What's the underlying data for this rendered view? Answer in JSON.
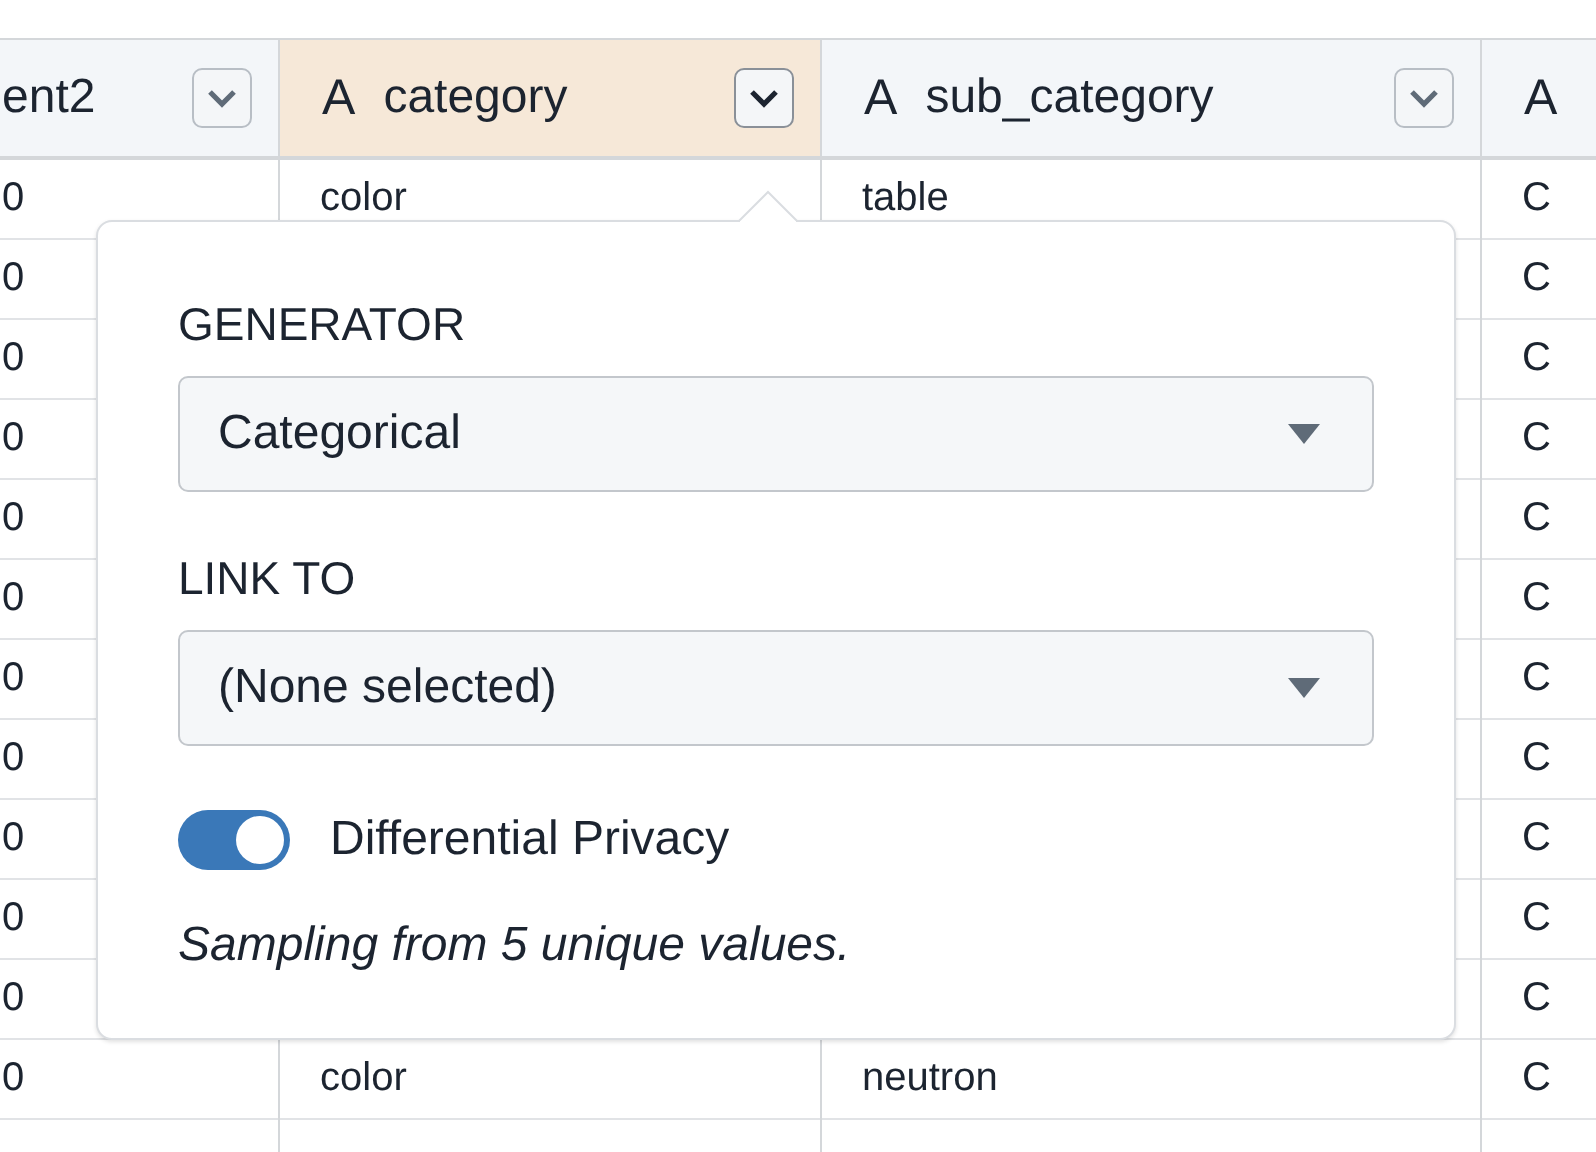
{
  "table": {
    "columns": [
      {
        "label": "ent2",
        "selected": false
      },
      {
        "label": "category",
        "type_glyph": "A",
        "selected": true
      },
      {
        "label": "sub_category",
        "type_glyph": "A",
        "selected": false
      },
      {
        "type_glyph": "A",
        "selected": false
      }
    ],
    "rows": [
      {
        "column_1": "0",
        "category": "color",
        "sub_category": "table",
        "column_4": "C"
      },
      {
        "column_1": "0",
        "column_4": "C"
      },
      {
        "column_1": "0",
        "column_4": "C"
      },
      {
        "column_1": "0",
        "column_4": "C"
      },
      {
        "column_1": "0",
        "column_4": "C"
      },
      {
        "column_1": "0",
        "column_4": "C"
      },
      {
        "column_1": "0",
        "column_4": "C"
      },
      {
        "column_1": "0",
        "column_4": "C"
      },
      {
        "column_1": "0",
        "column_4": "C"
      },
      {
        "column_1": "0",
        "column_4": "C"
      },
      {
        "column_1": "0",
        "column_4": "C"
      },
      {
        "column_1": "0",
        "category": "color",
        "sub_category": "neutron",
        "column_4": "C"
      }
    ]
  },
  "popover": {
    "generator": {
      "label": "GENERATOR",
      "value": "Categorical"
    },
    "link_to": {
      "label": "LINK TO",
      "value": "(None selected)"
    },
    "differential_privacy": {
      "label": "Differential Privacy",
      "on": true
    },
    "note": "Sampling from 5 unique values."
  }
}
